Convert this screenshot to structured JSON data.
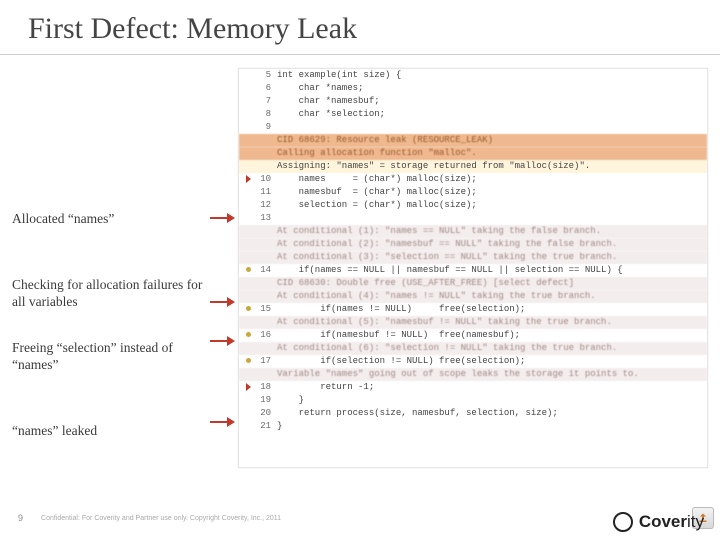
{
  "title": "First Defect: Memory Leak",
  "annotations": [
    "Allocated “names”",
    "Checking for allocation failures for all variables",
    "Freeing “selection” instead of “names”",
    "“names” leaked"
  ],
  "code_lines": [
    {
      "ln": "5",
      "type": "code",
      "marker": "",
      "text": "int example(int size) {"
    },
    {
      "ln": "6",
      "type": "code",
      "marker": "",
      "text": "    char *names;"
    },
    {
      "ln": "7",
      "type": "code",
      "marker": "",
      "text": "    char *namesbuf;"
    },
    {
      "ln": "8",
      "type": "code",
      "marker": "",
      "text": "    char *selection;"
    },
    {
      "ln": "9",
      "type": "code",
      "marker": "",
      "text": ""
    },
    {
      "ln": "",
      "type": "defect",
      "marker": "",
      "text": "CID 68629: Resource leak (RESOURCE_LEAK)"
    },
    {
      "ln": "",
      "type": "defect",
      "marker": "",
      "text": "Calling allocation function \"malloc\"."
    },
    {
      "ln": "",
      "type": "highlight",
      "marker": "",
      "text": "Assigning: \"names\" = storage returned from \"malloc(size)\"."
    },
    {
      "ln": "10",
      "type": "code",
      "marker": "tri",
      "text": "    names     = (char*) malloc(size);"
    },
    {
      "ln": "11",
      "type": "code",
      "marker": "",
      "text": "    namesbuf  = (char*) malloc(size);"
    },
    {
      "ln": "12",
      "type": "code",
      "marker": "",
      "text": "    selection = (char*) malloc(size);"
    },
    {
      "ln": "13",
      "type": "code",
      "marker": "",
      "text": ""
    },
    {
      "ln": "",
      "type": "analysis",
      "marker": "",
      "text": "At conditional (1): \"names == NULL\" taking the false branch."
    },
    {
      "ln": "",
      "type": "analysis",
      "marker": "",
      "text": "At conditional (2): \"namesbuf == NULL\" taking the false branch."
    },
    {
      "ln": "",
      "type": "analysis",
      "marker": "",
      "text": "At conditional (3): \"selection == NULL\" taking the true branch."
    },
    {
      "ln": "14",
      "type": "code",
      "marker": "dot",
      "text": "    if(names == NULL || namesbuf == NULL || selection == NULL) {"
    },
    {
      "ln": "",
      "type": "analysis",
      "marker": "",
      "text": "CID 68630: Double free (USE_AFTER_FREE) [select defect]"
    },
    {
      "ln": "",
      "type": "analysis",
      "marker": "",
      "text": "At conditional (4): \"names != NULL\" taking the true branch."
    },
    {
      "ln": "15",
      "type": "code",
      "marker": "dot",
      "text": "        if(names != NULL)     free(selection);"
    },
    {
      "ln": "",
      "type": "analysis",
      "marker": "",
      "text": "At conditional (5): \"namesbuf != NULL\" taking the true branch."
    },
    {
      "ln": "16",
      "type": "code",
      "marker": "dot",
      "text": "        if(namesbuf != NULL)  free(namesbuf);"
    },
    {
      "ln": "",
      "type": "analysis",
      "marker": "",
      "text": "At conditional (6): \"selection != NULL\" taking the true branch."
    },
    {
      "ln": "17",
      "type": "code",
      "marker": "dot",
      "text": "        if(selection != NULL) free(selection);"
    },
    {
      "ln": "",
      "type": "analysis",
      "marker": "",
      "text": "Variable \"names\" going out of scope leaks the storage it points to."
    },
    {
      "ln": "18",
      "type": "code",
      "marker": "tri",
      "text": "        return -1;"
    },
    {
      "ln": "19",
      "type": "code",
      "marker": "",
      "text": "    }"
    },
    {
      "ln": "20",
      "type": "code",
      "marker": "",
      "text": "    return process(size, namesbuf, selection, size);"
    },
    {
      "ln": "21",
      "type": "code",
      "marker": "",
      "text": "}"
    }
  ],
  "footer": {
    "page": "9",
    "confidential": "Confidential: For Coverity and Partner use only. Copyright Coverity, Inc., 2011"
  },
  "logo": "Coverity"
}
